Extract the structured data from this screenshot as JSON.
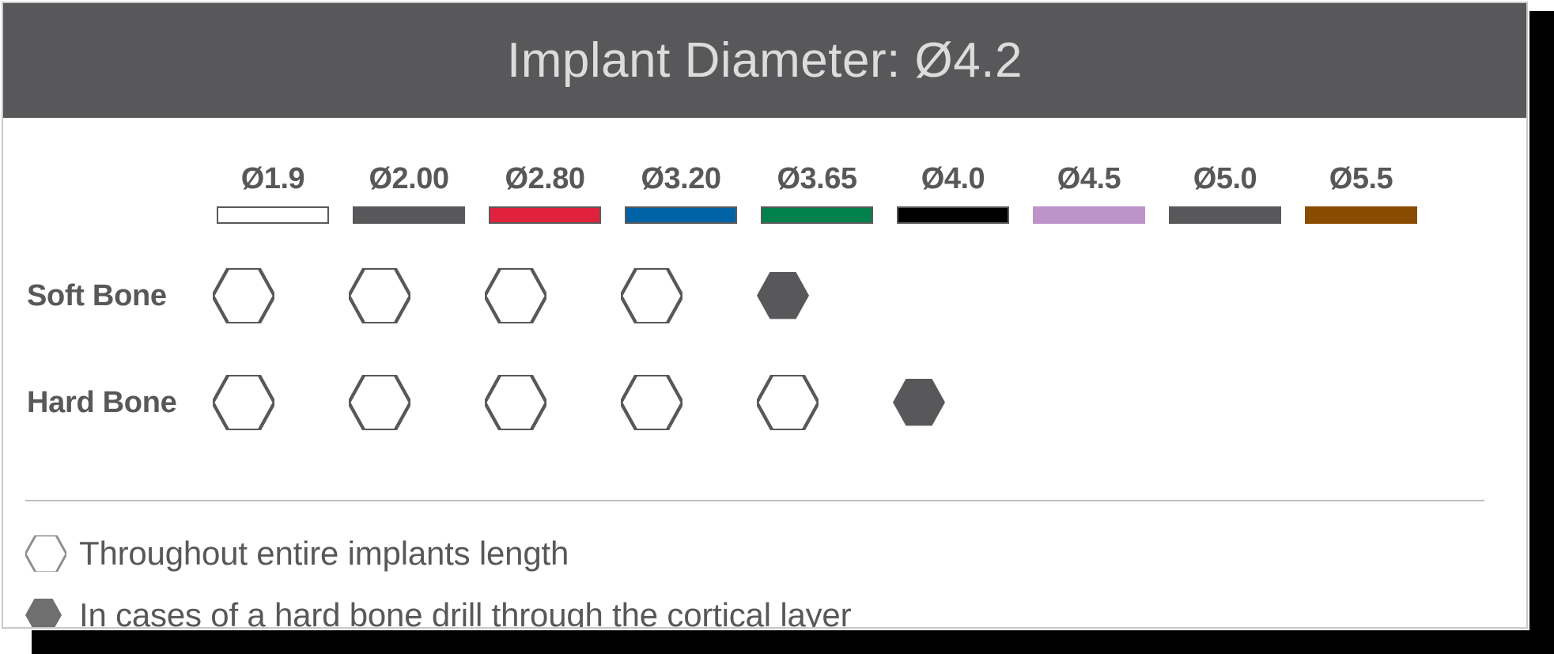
{
  "header": {
    "title": "Implant Diameter: Ø4.2",
    "background": "#58585a",
    "text_color": "#dcdcdc"
  },
  "columns": [
    {
      "label": "Ø1.9",
      "bar_color": "#ffffff",
      "bar_border": "#58585a"
    },
    {
      "label": "Ø2.00",
      "bar_color": "#58585a",
      "bar_border": "#58585a"
    },
    {
      "label": "Ø2.80",
      "bar_color": "#e0223c",
      "bar_border": "#58585a"
    },
    {
      "label": "Ø3.20",
      "bar_color": "#0063a6",
      "bar_border": "#58585a"
    },
    {
      "label": "Ø3.65",
      "bar_color": "#00804a",
      "bar_border": "#58585a"
    },
    {
      "label": "Ø4.0",
      "bar_color": "#000000",
      "bar_border": "#58585a"
    },
    {
      "label": "Ø4.5",
      "bar_color": "#bd93c9",
      "bar_border": "#bd93c9"
    },
    {
      "label": "Ø5.0",
      "bar_color": "#58585a",
      "bar_border": "#58585a"
    },
    {
      "label": "Ø5.5",
      "bar_color": "#8a4a00",
      "bar_border": "#8a4a00"
    }
  ],
  "rows": [
    {
      "label": "Soft Bone",
      "marks": [
        "outline",
        "outline",
        "outline",
        "outline",
        "filled",
        "none",
        "none",
        "none",
        "none"
      ]
    },
    {
      "label": "Hard Bone",
      "marks": [
        "outline",
        "outline",
        "outline",
        "outline",
        "outline",
        "filled",
        "none",
        "none",
        "none"
      ]
    }
  ],
  "legend": [
    {
      "marker": "outline",
      "text": "Throughout entire implants length"
    },
    {
      "marker": "filled",
      "text": "In cases of a hard bone drill through the cortical layer"
    }
  ],
  "colors": {
    "hex_stroke": "#58585a",
    "hex_fill": "#58585a",
    "divider": "#bdbdbd",
    "card_border": "#c9c9c9",
    "shadow": "#000000"
  },
  "chart_data": {
    "type": "table",
    "title": "Implant Diameter: Ø4.2",
    "categories": [
      "Ø1.9",
      "Ø2.00",
      "Ø2.80",
      "Ø3.20",
      "Ø3.65",
      "Ø4.0",
      "Ø4.5",
      "Ø5.0",
      "Ø5.5"
    ],
    "series": [
      {
        "name": "Soft Bone",
        "values": [
          "outline",
          "outline",
          "outline",
          "outline",
          "filled",
          "",
          "",
          "",
          ""
        ]
      },
      {
        "name": "Hard Bone",
        "values": [
          "outline",
          "outline",
          "outline",
          "outline",
          "outline",
          "filled",
          "",
          "",
          ""
        ]
      }
    ],
    "legend": [
      "Throughout entire implants length",
      "In cases of a hard bone drill through the cortical layer"
    ],
    "legend_position": "bottom",
    "grid": false
  }
}
